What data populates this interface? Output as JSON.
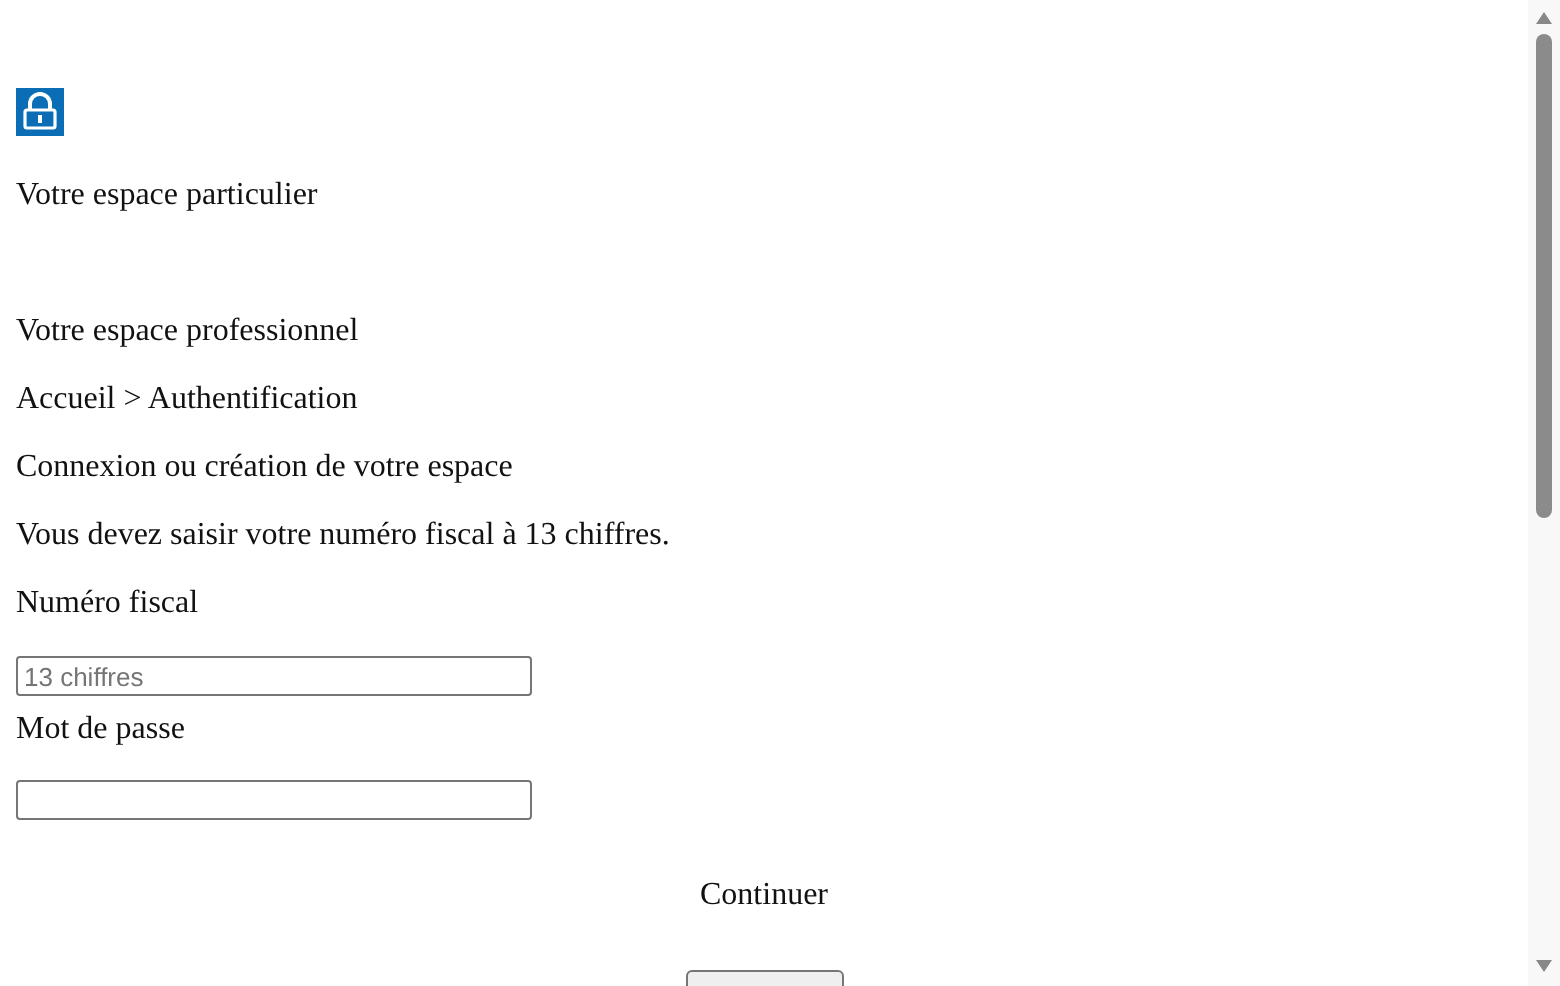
{
  "header": {
    "personal_space": "Votre espace particulier",
    "professional_space": "Votre espace professionnel"
  },
  "breadcrumb": "Accueil > Authentification",
  "heading": "Connexion ou création de votre espace",
  "instruction": "Vous devez saisir votre numéro fiscal à 13 chiffres.",
  "fields": [
    {
      "label": "Numéro fiscal",
      "placeholder": "13 chiffres"
    },
    {
      "label": "Mot de passe"
    }
  ],
  "continue_label": "Continuer"
}
